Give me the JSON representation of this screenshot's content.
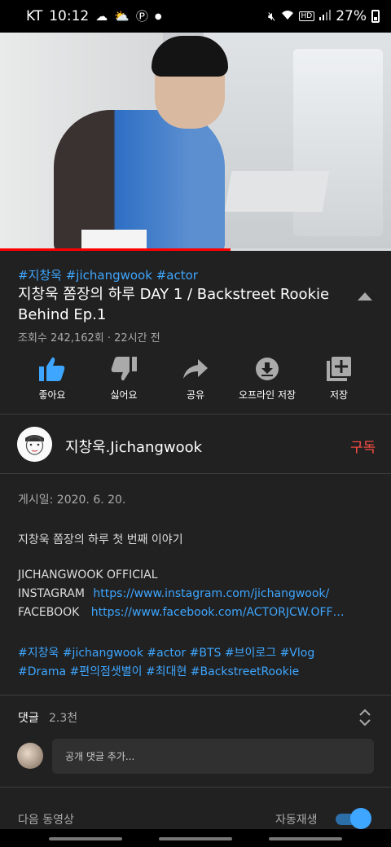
{
  "status_bar": {
    "carrier": "KT",
    "time": "10:12",
    "network": "HD",
    "battery": "27%"
  },
  "video": {
    "progress_fraction": 0.59,
    "progress_color": "#ff0000"
  },
  "details": {
    "tags": "#지창욱 #jichangwook #actor",
    "title": "지창욱 쫌장의 하루 DAY 1 / Backstreet Rookie Behind Ep.1",
    "meta": "조회수 242,162회 · 22시간 전"
  },
  "actions": [
    {
      "label": "좋아요",
      "icon": "thumbs-up-icon",
      "active": true
    },
    {
      "label": "싫어요",
      "icon": "thumbs-down-icon",
      "active": false
    },
    {
      "label": "공유",
      "icon": "share-icon",
      "active": false
    },
    {
      "label": "오프라인 저장",
      "icon": "download-icon",
      "active": false
    },
    {
      "label": "저장",
      "icon": "add-to-playlist-icon",
      "active": false
    }
  ],
  "channel": {
    "name": "지창욱.Jichangwook",
    "subscribe_label": "구독"
  },
  "description": {
    "date": "게시일: 2020. 6. 20.",
    "body": "지창욱 쫌장의 하루 첫 번째 이야기",
    "official": "JICHANGWOOK OFFICIAL",
    "instagram_label": "INSTAGRAM",
    "instagram_url": "https://www.instagram.com/jichangwook/",
    "facebook_label": "FACEBOOK",
    "facebook_url": "https://www.facebook.com/ACTORJCW.OFF…",
    "hashtags_line1": "#지창욱 #jichangwook #actor #BTS #브이로그 #Vlog",
    "hashtags_line2": "#Drama #편의점샛별이 #최대현 #BackstreetRookie"
  },
  "comments": {
    "label": "댓글",
    "count": "2.3천",
    "placeholder": "공개 댓글 추가..."
  },
  "up_next": {
    "label": "다음 동영상",
    "autoplay_label": "자동재생",
    "autoplay_on": true
  },
  "colors": {
    "accent_blue": "#3ea6ff",
    "subscribe_red": "#ff4e45",
    "background": "#212121"
  }
}
